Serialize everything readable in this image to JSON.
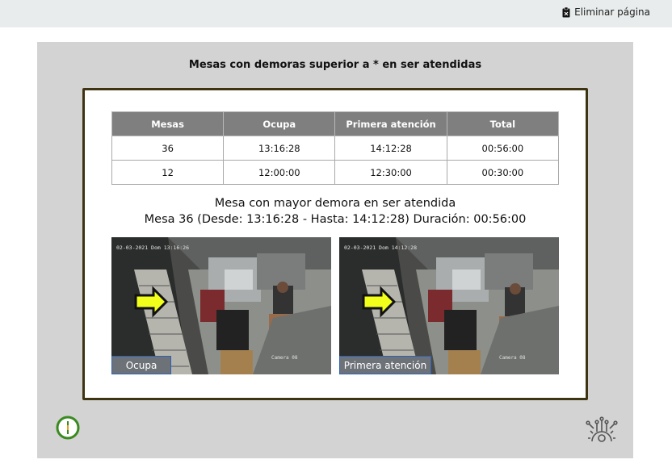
{
  "toolbar": {
    "delete_label": "Eliminar página",
    "delete_icon": "clipboard-delete-icon"
  },
  "report": {
    "title": "Mesas con demoras superior a * en ser atendidas",
    "table": {
      "headers": [
        "Mesas",
        "Ocupa",
        "Primera atención",
        "Total"
      ],
      "rows": [
        [
          "36",
          "13:16:28",
          "14:12:28",
          "00:56:00"
        ],
        [
          "12",
          "12:00:00",
          "12:30:00",
          "00:30:00"
        ]
      ]
    },
    "summary_line1": "Mesa con mayor demora en ser atendida",
    "summary_line2": "Mesa 36 (Desde: 13:16:28 - Hasta: 14:12:28) Duración: 00:56:00",
    "cameras": [
      {
        "label": "Ocupa",
        "timestamp": "02-03-2021 Dom 13:16:26",
        "camera_name": "Camera 08"
      },
      {
        "label": "Primera atención",
        "timestamp": "02-03-2021 Dom 14:12:28",
        "camera_name": "Camera 08"
      }
    ]
  },
  "footer": {
    "left_icon": "info-circle-icon",
    "right_icon": "circuit-gear-icon"
  },
  "colors": {
    "card_border": "#3e3411",
    "header_bg": "#7f7f7f",
    "arrow_fill": "#f2ff1a",
    "info_green": "#3a8a1f"
  }
}
